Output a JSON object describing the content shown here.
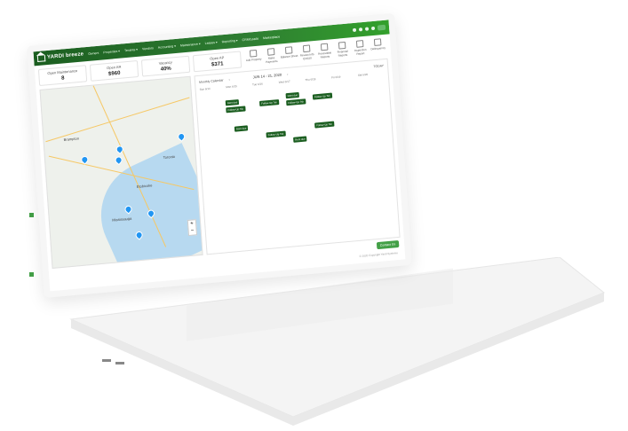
{
  "app": {
    "logo_text": "YARDI breeze"
  },
  "nav": {
    "items": [
      "Owners",
      "Properties ▾",
      "Tenants ▾",
      "Vendors",
      "Accounting ▾",
      "Maintenance ▾",
      "Leases ▾",
      "Reporting ▾",
      "CRM/Leads",
      "Marketplace"
    ]
  },
  "kpis": [
    {
      "label": "Open Maintenance",
      "value": "8"
    },
    {
      "label": "Open AR",
      "value": "$960"
    },
    {
      "label": "Vacancy",
      "value": "40%"
    },
    {
      "label": "Open AP",
      "value": "$371"
    }
  ],
  "tools": [
    "Add Property",
    "Make Payments",
    "Balance Sheet",
    "Review Info Q'2020",
    "Receivable Reports",
    "Financial Reports",
    "Inspection Report",
    "Delinquency"
  ],
  "map": {
    "labels": [
      "Brampton",
      "Toronto",
      "Mississauga",
      "Etobicoke"
    ],
    "zoom_in": "+",
    "zoom_out": "−"
  },
  "calendar": {
    "view_label": "Monthly Calendar",
    "range": "JUN 14 - 21, 2020",
    "today_label": "TODAY",
    "days": [
      "Sun 6/14",
      "Mon 6/15",
      "Tue 6/16",
      "Wed 6/17",
      "Thu 6/18",
      "Fri 6/19",
      "Sat 6/20"
    ],
    "events": [
      "Rent due",
      "Follow-Up Tsk",
      "Follow-Up Tsk",
      "Rent due",
      "Follow-Up Tsk",
      "Follow-Up Tsk",
      "Rent due",
      "Follow-Up Tsk",
      "Rent due",
      "Follow-Up Tsk"
    ]
  },
  "footer": {
    "copyright": "© 2020 Copyright Yardi Systems",
    "fab": "Contact Us"
  }
}
